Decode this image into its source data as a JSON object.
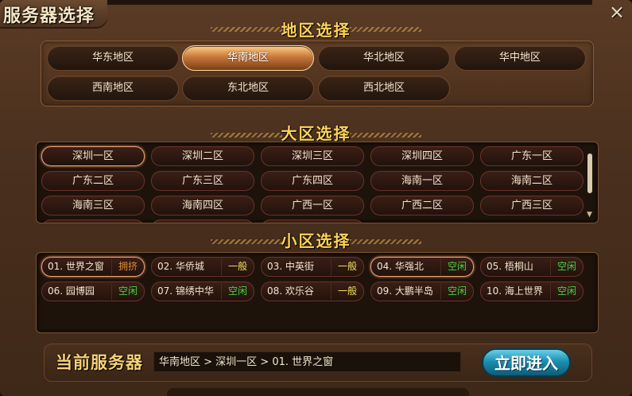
{
  "title": "服务器选择",
  "close_icon": "×",
  "region": {
    "heading": "地区选择",
    "items": [
      "华东地区",
      "华南地区",
      "华北地区",
      "华中地区",
      "西南地区",
      "东北地区",
      "西北地区"
    ],
    "selected": 1
  },
  "zone": {
    "heading": "大区选择",
    "items": [
      "深圳一区",
      "深圳二区",
      "深圳三区",
      "深圳四区",
      "广东一区",
      "广东二区",
      "广东三区",
      "广东四区",
      "海南一区",
      "海南二区",
      "海南三区",
      "海南四区",
      "广西一区",
      "广西二区",
      "广西三区"
    ],
    "selected": 0,
    "scroll_arrow": "▼"
  },
  "server": {
    "heading": "小区选择",
    "items": [
      {
        "name": "01. 世界之窗",
        "status": "拥挤",
        "level": "busy"
      },
      {
        "name": "02. 华侨城",
        "status": "一般",
        "level": "normal"
      },
      {
        "name": "03. 中英街",
        "status": "一般",
        "level": "normal"
      },
      {
        "name": "04. 华强北",
        "status": "空闲",
        "level": "idle"
      },
      {
        "name": "05. 梧桐山",
        "status": "空闲",
        "level": "idle"
      },
      {
        "name": "06. 园博园",
        "status": "空闲",
        "level": "idle"
      },
      {
        "name": "07. 锦绣中华",
        "status": "空闲",
        "level": "idle"
      },
      {
        "name": "08. 欢乐谷",
        "status": "一般",
        "level": "normal"
      },
      {
        "name": "09. 大鹏半岛",
        "status": "空闲",
        "level": "idle"
      },
      {
        "name": "10. 海上世界",
        "status": "空闲",
        "level": "idle"
      }
    ],
    "selected": [
      0,
      3
    ]
  },
  "footer": {
    "current_label": "当前服务器",
    "path": "华南地区 > 深圳一区 > 01. 世界之窗",
    "enter_label": "立即进入"
  },
  "colors": {
    "accent": "#ffd35a",
    "busy": "#e08a3a",
    "normal": "#f0e060",
    "idle": "#48d048",
    "enter": "#1c8fb0"
  }
}
